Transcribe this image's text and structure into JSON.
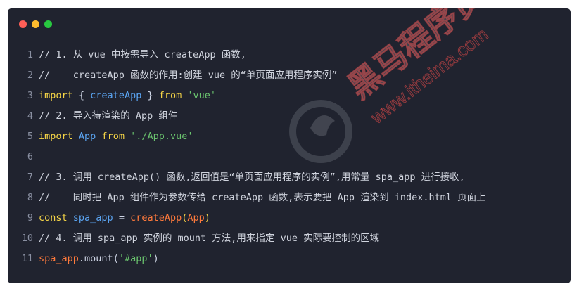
{
  "window": {
    "controls": {
      "close_icon": "red-dot",
      "minimize_icon": "yellow-dot",
      "maximize_icon": "green-dot"
    }
  },
  "watermark": {
    "brand_text": "黑马程序员",
    "url_text": "www.itheima.com"
  },
  "colors": {
    "background": "#20232f",
    "comment": "#d0d4de",
    "keyword": "#f5d547",
    "identifier": "#5aa3f0",
    "string": "#6ac36e",
    "function": "#ff7a3c",
    "line_number": "#8a90a2"
  },
  "code": {
    "lines": [
      {
        "n": "1",
        "tokens": [
          {
            "t": "// 1. 从 vue 中按需导入 createApp 函数,",
            "c": "comment"
          }
        ]
      },
      {
        "n": "2",
        "tokens": [
          {
            "t": "//    createApp 函数的作用:创建 vue 的“单页面应用程序实例”",
            "c": "comment"
          }
        ]
      },
      {
        "n": "3",
        "tokens": [
          {
            "t": "import",
            "c": "keyword"
          },
          {
            "t": " { ",
            "c": "punct"
          },
          {
            "t": "createApp",
            "c": "ident"
          },
          {
            "t": " } ",
            "c": "punct"
          },
          {
            "t": "from",
            "c": "keyword"
          },
          {
            "t": " ",
            "c": "punct"
          },
          {
            "t": "'vue'",
            "c": "string"
          }
        ]
      },
      {
        "n": "4",
        "tokens": [
          {
            "t": "// 2. 导入待渲染的 App 组件",
            "c": "comment"
          }
        ]
      },
      {
        "n": "5",
        "tokens": [
          {
            "t": "import",
            "c": "keyword"
          },
          {
            "t": " ",
            "c": "punct"
          },
          {
            "t": "App",
            "c": "ident"
          },
          {
            "t": " ",
            "c": "punct"
          },
          {
            "t": "from",
            "c": "keyword"
          },
          {
            "t": " ",
            "c": "punct"
          },
          {
            "t": "'./App.vue'",
            "c": "string"
          }
        ]
      },
      {
        "n": "6",
        "tokens": []
      },
      {
        "n": "7",
        "tokens": [
          {
            "t": "// 3. 调用 createApp() 函数,返回值是“单页面应用程序的实例”,用常量 spa_app 进行接收,",
            "c": "comment"
          }
        ]
      },
      {
        "n": "8",
        "tokens": [
          {
            "t": "//    同时把 App 组件作为参数传给 createApp 函数,表示要把 App 渲染到 index.html 页面上",
            "c": "comment"
          }
        ]
      },
      {
        "n": "9",
        "tokens": [
          {
            "t": "const",
            "c": "keyword"
          },
          {
            "t": " ",
            "c": "punct"
          },
          {
            "t": "spa_app",
            "c": "ident"
          },
          {
            "t": " = ",
            "c": "punct"
          },
          {
            "t": "createApp",
            "c": "func"
          },
          {
            "t": "(",
            "c": "paren"
          },
          {
            "t": "App",
            "c": "func"
          },
          {
            "t": ")",
            "c": "paren"
          }
        ]
      },
      {
        "n": "10",
        "tokens": [
          {
            "t": "// 4. 调用 spa_app 实例的 mount 方法,用来指定 vue 实际要控制的区域",
            "c": "comment"
          }
        ]
      },
      {
        "n": "11",
        "tokens": [
          {
            "t": "spa_app",
            "c": "func"
          },
          {
            "t": ".mount(",
            "c": "punct"
          },
          {
            "t": "'#app'",
            "c": "string"
          },
          {
            "t": ")",
            "c": "punct"
          }
        ]
      }
    ]
  }
}
